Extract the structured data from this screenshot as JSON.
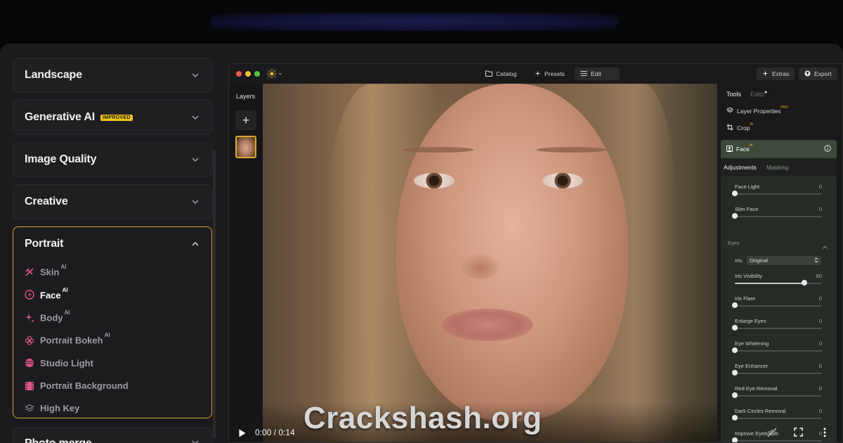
{
  "left_menu": {
    "sections": [
      {
        "title": "Landscape"
      },
      {
        "title": "Generative AI",
        "badge": "IMPROVED"
      },
      {
        "title": "Image Quality"
      },
      {
        "title": "Creative"
      }
    ],
    "portrait": {
      "title": "Portrait",
      "items": [
        {
          "label": "Skin",
          "ai": "AI",
          "icon": "skin-brush-icon",
          "color": "#e0558a"
        },
        {
          "label": "Face",
          "ai": "AI",
          "icon": "face-bolt-icon",
          "color": "#e0558a"
        },
        {
          "label": "Body",
          "ai": "AI",
          "icon": "body-sparkle-icon",
          "color": "#e0558a"
        },
        {
          "label": "Portrait Bokeh",
          "ai": "AI",
          "icon": "bokeh-flower-icon",
          "color": "#e0558a"
        },
        {
          "label": "Studio Light",
          "icon": "studio-light-icon",
          "color": "#e0558a"
        },
        {
          "label": "Portrait Background",
          "icon": "film-strip-icon",
          "color": "#e0558a"
        },
        {
          "label": "High Key",
          "icon": "layers-icon",
          "color": "#8b8b90"
        }
      ]
    },
    "next_section": "Photo merge",
    "accent_border": "#d9a52a"
  },
  "app": {
    "toolbar": {
      "catalog": "Catalog",
      "presets": "Presets",
      "edit": "Edit",
      "extras": "Extras",
      "export": "Export"
    },
    "layers_label": "Layers",
    "tools_tab": "Tools",
    "edits_tab": "Edits",
    "layer_properties": "Layer Properties",
    "layer_properties_badge": "PRO",
    "crop": "Crop",
    "crop_badge": "AI",
    "face_panel": {
      "title": "Face",
      "badge": "AI",
      "tab_adjustments": "Adjustments",
      "tab_masking": "Masking",
      "eyes_section": "Eyes",
      "iris_label": "Iris:",
      "iris_value": "Original",
      "sliders": [
        {
          "label": "Face Light",
          "value": 0
        },
        {
          "label": "Slim Face",
          "value": 0
        },
        {
          "label": "Iris Visibility",
          "value": 80
        },
        {
          "label": "Iris Flare",
          "value": 0
        },
        {
          "label": "Enlarge Eyes",
          "value": 0
        },
        {
          "label": "Eye Whitening",
          "value": 0
        },
        {
          "label": "Eye Enhancer",
          "value": 0
        },
        {
          "label": "Red Eye Removal",
          "value": 0
        },
        {
          "label": "Dark Circles Removal",
          "value": 0
        },
        {
          "label": "Improve Eyebrows",
          "value": 0
        }
      ]
    }
  },
  "video": {
    "time": "0:00 / 0:14"
  },
  "watermark": "Crackshash.org"
}
